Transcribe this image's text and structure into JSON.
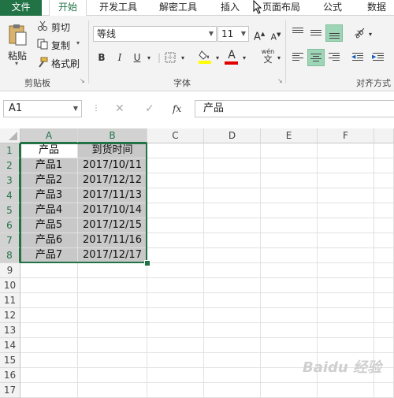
{
  "tabs": [
    "文件",
    "开始",
    "开发工具",
    "解密工具",
    "插入",
    "页面布局",
    "公式",
    "数据"
  ],
  "ribbon": {
    "paste": "粘贴",
    "cut": "剪切",
    "copy": "复制",
    "format_painter": "格式刷",
    "clipboard_group": "剪贴板",
    "font_name": "等线",
    "font_size": "11",
    "bold": "B",
    "italic": "I",
    "underline": "U",
    "font_group": "字体",
    "align_group": "对齐方式",
    "wen": "wén",
    "wen_char": "文",
    "grow_font": "A",
    "shrink_font": "A",
    "font_color_letter": "A"
  },
  "formula_bar": {
    "name_box": "A1",
    "fx": "fx",
    "cancel": "✕",
    "enter": "✓",
    "content": "产品"
  },
  "columns": [
    "A",
    "B",
    "C",
    "D",
    "E",
    "F"
  ],
  "rows": [
    "1",
    "2",
    "3",
    "4",
    "5",
    "6",
    "7",
    "8",
    "9",
    "10",
    "11",
    "12",
    "13",
    "14",
    "15",
    "16",
    "17"
  ],
  "table": {
    "headers": [
      "产品",
      "到货时间"
    ],
    "data": [
      [
        "产品1",
        "2017/10/11"
      ],
      [
        "产品2",
        "2017/12/12"
      ],
      [
        "产品3",
        "2017/11/13"
      ],
      [
        "产品4",
        "2017/10/14"
      ],
      [
        "产品5",
        "2017/12/15"
      ],
      [
        "产品6",
        "2017/11/16"
      ],
      [
        "产品7",
        "2017/12/17"
      ]
    ]
  },
  "colors": {
    "accent": "#217346",
    "selection": "#c8c8c8",
    "font_color": "#e00000",
    "highlight": "#ffff00"
  },
  "watermark": "Baidu 经验"
}
